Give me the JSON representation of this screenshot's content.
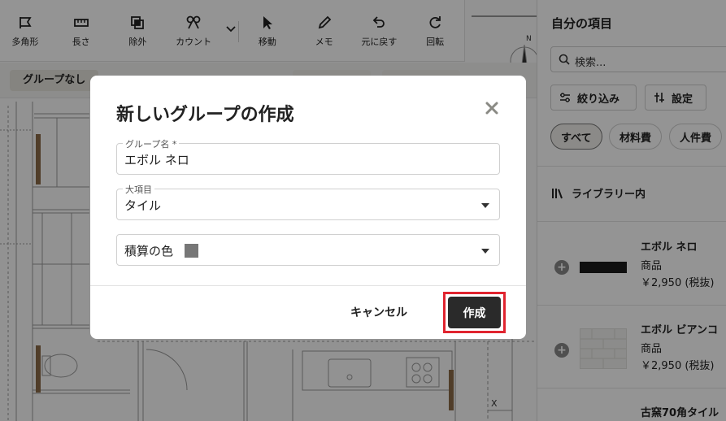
{
  "toolbar": {
    "tools": [
      {
        "label": "多角形",
        "icon": "polygon-icon"
      },
      {
        "label": "長さ",
        "icon": "ruler-icon"
      },
      {
        "label": "除外",
        "icon": "exclude-icon"
      },
      {
        "label": "カウント",
        "icon": "count-icon"
      },
      {
        "label": "移動",
        "icon": "cursor-arrow-icon"
      },
      {
        "label": "メモ",
        "icon": "pen-icon"
      },
      {
        "label": "元に戻す",
        "icon": "undo-icon"
      },
      {
        "label": "回転",
        "icon": "rotate-icon"
      }
    ]
  },
  "group_strip": {
    "chip_label": "グループなし"
  },
  "panel": {
    "title": "自分の項目",
    "search_placeholder": "検索...",
    "filter_label": "絞り込み",
    "settings_label": "設定",
    "chips": [
      "すべて",
      "材料費",
      "人件費"
    ],
    "library_label": "ライブラリー内",
    "items": [
      {
        "name": "エボル ネロ",
        "type": "商品",
        "price": "￥2,950 (税抜)"
      },
      {
        "name": "エボル ビアンコ",
        "type": "商品",
        "price": "￥2,950 (税抜)"
      },
      {
        "name": "古窯70角タイル",
        "type": "",
        "price": ""
      }
    ]
  },
  "modal": {
    "title": "新しいグループの作成",
    "group_name_label": "グループ名 *",
    "group_name_value": "エボル ネロ",
    "category_label": "大項目",
    "category_value": "タイル",
    "color_label": "積算の色",
    "color_value": "#777777",
    "cancel_label": "キャンセル",
    "create_label": "作成"
  },
  "colors": {
    "highlight": "#e0242f",
    "primary_button": "#2a2a2a"
  }
}
